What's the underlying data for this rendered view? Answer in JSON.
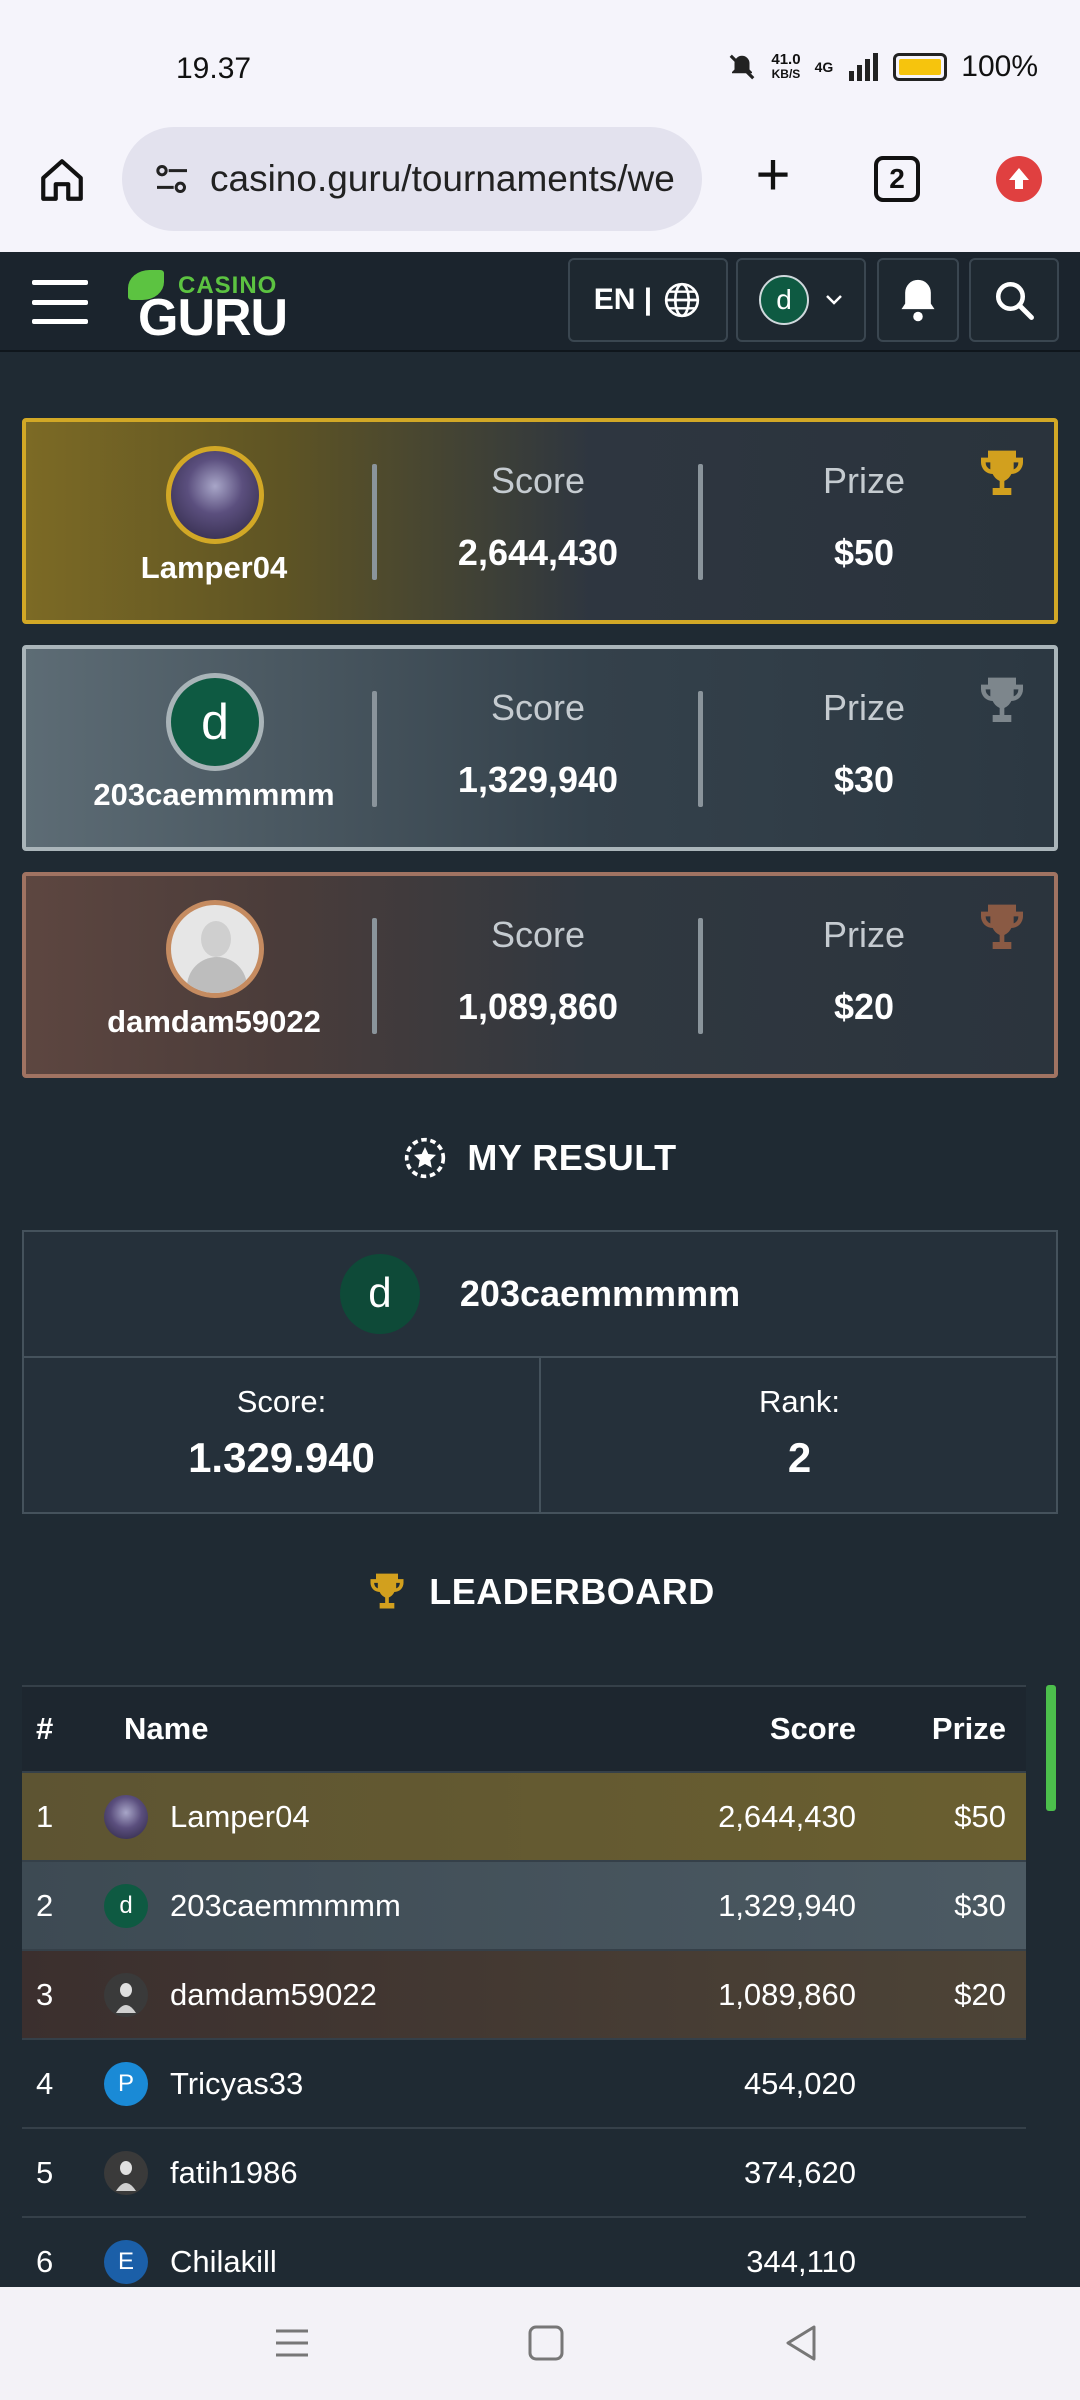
{
  "status": {
    "time": "19.37",
    "netspeed_value": "41.0",
    "netspeed_unit": "KB/S",
    "network": "4G",
    "battery": "100%"
  },
  "browser": {
    "url": "casino.guru/tournaments/we",
    "tab_count": "2"
  },
  "header": {
    "logo_top": "CASINO",
    "logo_bottom": "GURU",
    "language": "EN |",
    "user_initial": "d"
  },
  "podium": [
    {
      "name": "Lamper04",
      "score_label": "Score",
      "score": "2,644,430",
      "prize_label": "Prize",
      "prize": "$50",
      "trophy_color": "#d2a01e"
    },
    {
      "name": "203caemmmmm",
      "initial": "d",
      "score_label": "Score",
      "score": "1,329,940",
      "prize_label": "Prize",
      "prize": "$30",
      "trophy_color": "#7d868c"
    },
    {
      "name": "damdam59022",
      "score_label": "Score",
      "score": "1,089,860",
      "prize_label": "Prize",
      "prize": "$20",
      "trophy_color": "#8a5a44"
    }
  ],
  "my_result": {
    "title": "MY RESULT",
    "initial": "d",
    "name": "203caemmmmm",
    "score_label": "Score:",
    "score": "1.329.940",
    "rank_label": "Rank:",
    "rank": "2"
  },
  "leaderboard": {
    "title": "LEADERBOARD",
    "headers": {
      "rank": "#",
      "name": "Name",
      "score": "Score",
      "prize": "Prize"
    },
    "rows": [
      {
        "rank": "1",
        "name": "Lamper04",
        "score": "2,644,430",
        "prize": "$50",
        "avatar": "image"
      },
      {
        "rank": "2",
        "name": "203caemmmmm",
        "score": "1,329,940",
        "prize": "$30",
        "avatar": "d"
      },
      {
        "rank": "3",
        "name": "damdam59022",
        "score": "1,089,860",
        "prize": "$20",
        "avatar": "default"
      },
      {
        "rank": "4",
        "name": "Tricyas33",
        "score": "454,020",
        "prize": "",
        "avatar": "P"
      },
      {
        "rank": "5",
        "name": "fatih1986",
        "score": "374,620",
        "prize": "",
        "avatar": "default"
      },
      {
        "rank": "6",
        "name": "Chilakill",
        "score": "344,110",
        "prize": "",
        "avatar": "E"
      }
    ]
  },
  "colors": {
    "accent_green": "#5cc341",
    "gold": "#d2a826",
    "silver": "#aab5ba",
    "bronze": "#a07362"
  }
}
